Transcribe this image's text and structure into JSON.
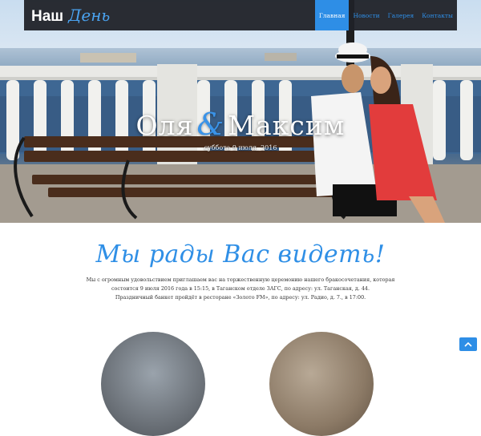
{
  "brand": {
    "main": "Наш",
    "script": "День"
  },
  "nav": {
    "items": [
      {
        "label": "Главная",
        "active": true
      },
      {
        "label": "Новости",
        "active": false
      },
      {
        "label": "Галерея",
        "active": false
      },
      {
        "label": "Контакты",
        "active": false
      }
    ]
  },
  "hero": {
    "name_bride": "Оля",
    "ampersand": "&",
    "name_groom": "Максим",
    "date": "суббота 9 июля, 2016"
  },
  "welcome": {
    "heading": "Мы рады Вас видеть!",
    "line1": "Мы с огромным удовольствием приглашаем вас на торжественную церемонию нашего бракосочетания, которая",
    "line2": "состоится 9 июля 2016 года в 15:15, в Таганском отделе ЗАГС, по адресу: ул. Таганская, д. 44.",
    "line3": "Праздничный банкет пройдёт в ресторане «Золото FM», по адресу: ул. Радио, д. 7., в 17:00."
  },
  "colors": {
    "accent": "#2e8ee6",
    "navbar": "#202228",
    "text": "#333333"
  },
  "icons": {
    "scroll_top": "chevron-up-icon"
  }
}
